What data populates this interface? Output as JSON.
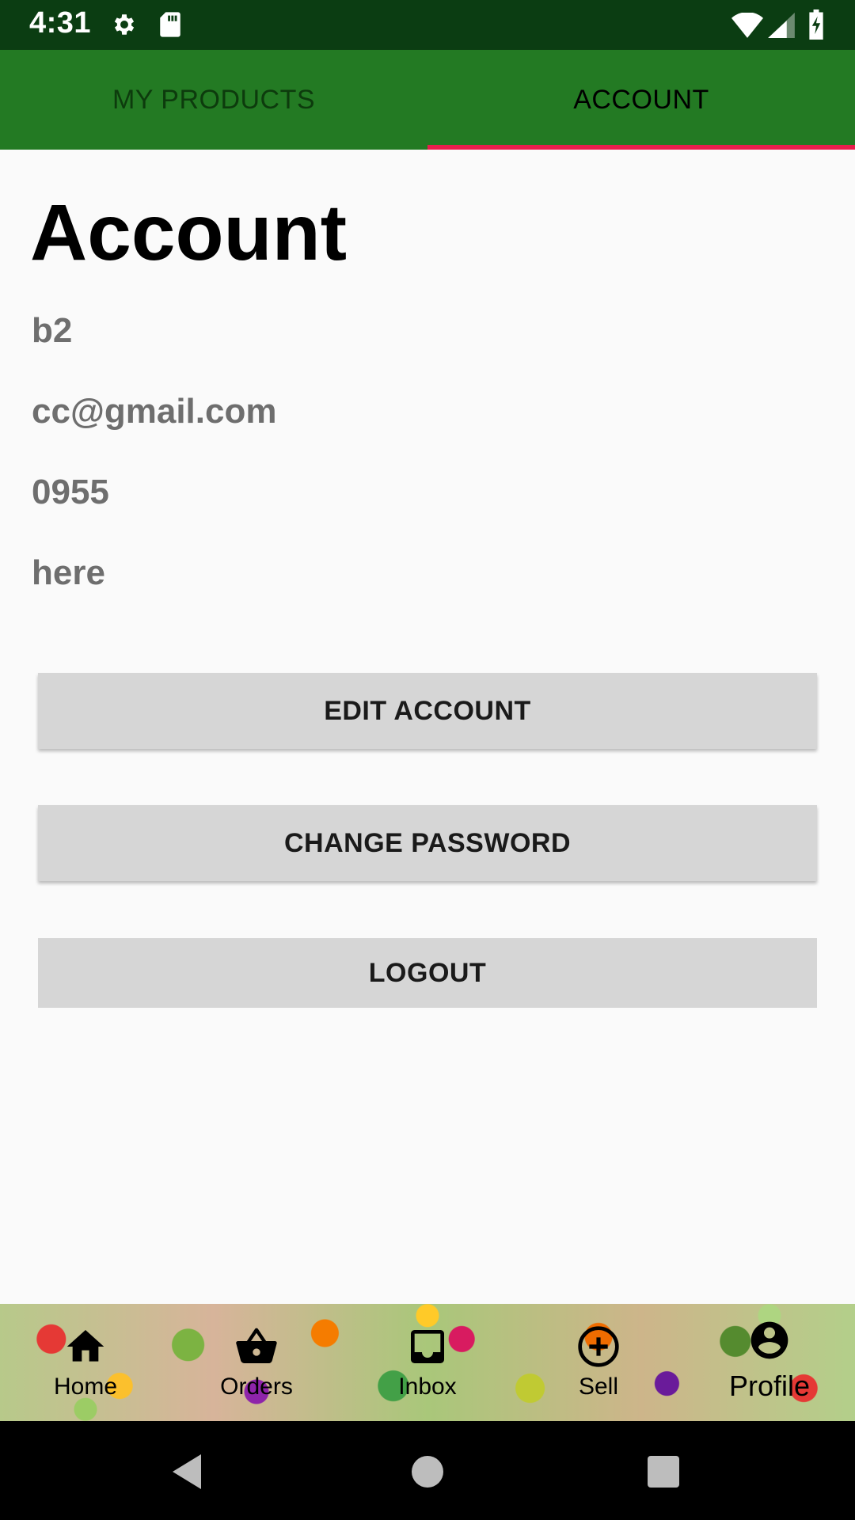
{
  "status_bar": {
    "time": "4:31",
    "icons": [
      "gear-icon",
      "sd-card-icon",
      "wifi-icon",
      "signal-icon",
      "battery-charging-icon"
    ]
  },
  "tabs": [
    {
      "label": "MY PRODUCTS",
      "selected": false
    },
    {
      "label": "ACCOUNT",
      "selected": true
    }
  ],
  "colors": {
    "status_bar": "#0b3d12",
    "tab_bar": "#237a23",
    "tab_indicator": "#e91e4d",
    "button_bg": "#d6d6d6",
    "info_text": "#6e6e6e"
  },
  "account": {
    "title": "Account",
    "name": "b2",
    "email": "cc@gmail.com",
    "phone": "0955",
    "address": "here"
  },
  "buttons": {
    "edit": "EDIT ACCOUNT",
    "change_password": "CHANGE PASSWORD",
    "logout": "LOGOUT"
  },
  "bottom_nav": [
    {
      "label": "Home",
      "icon": "home-icon"
    },
    {
      "label": "Orders",
      "icon": "basket-icon"
    },
    {
      "label": "Inbox",
      "icon": "inbox-icon"
    },
    {
      "label": "Sell",
      "icon": "add-circle-icon"
    },
    {
      "label": "Profile",
      "icon": "profile-icon"
    }
  ],
  "system_nav": [
    "back-icon",
    "home-circle-icon",
    "recents-icon"
  ]
}
